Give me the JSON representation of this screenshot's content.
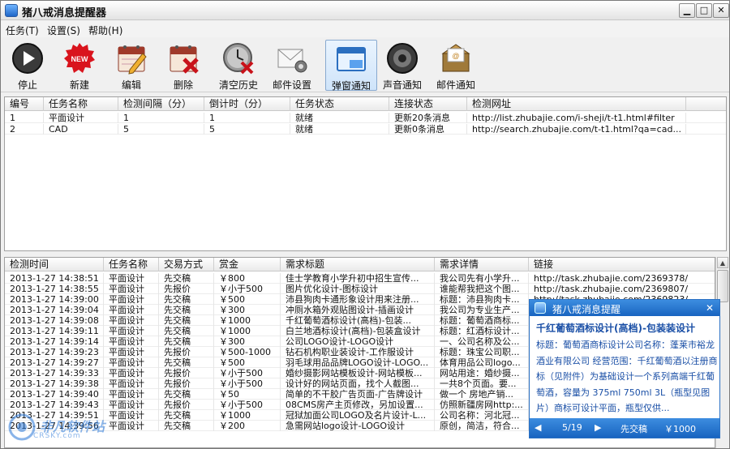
{
  "window": {
    "title": "猪八戒消息提醒器"
  },
  "menu": [
    {
      "label": "任务(T)"
    },
    {
      "label": "设置(S)"
    },
    {
      "label": "帮助(H)"
    }
  ],
  "toolbar": [
    {
      "label": "停止",
      "icon": "stop-icon"
    },
    {
      "label": "新建",
      "icon": "new-icon",
      "badge": "NEW"
    },
    {
      "label": "编辑",
      "icon": "edit-calendar-icon"
    },
    {
      "label": "删除",
      "icon": "delete-calendar-icon"
    },
    {
      "label": "清空历史",
      "icon": "clear-history-clock-icon"
    },
    {
      "label": "邮件设置",
      "icon": "mail-settings-icon"
    },
    {
      "label": "弹窗通知",
      "icon": "popup-notify-icon",
      "active": true
    },
    {
      "label": "声音通知",
      "icon": "speaker-icon"
    },
    {
      "label": "邮件通知",
      "icon": "mail-notify-icon"
    }
  ],
  "tasks": {
    "columns": [
      "编号",
      "任务名称",
      "检测间隔（分）",
      "倒计时（分）",
      "任务状态",
      "连接状态",
      "检测网址"
    ],
    "rows": [
      [
        "1",
        "平面设计",
        "1",
        "1",
        "就绪",
        "更新20条消息",
        "http://list.zhubajie.com/i-sheji/t-t1.html#filter"
      ],
      [
        "2",
        "CAD",
        "5",
        "5",
        "就绪",
        "更新0条消息",
        "http://search.zhubajie.com/t-t1.html?qa=cad..."
      ]
    ]
  },
  "history": {
    "columns": [
      "检测时间",
      "任务名称",
      "交易方式",
      "赏金",
      "需求标题",
      "需求详情",
      "链接"
    ],
    "rows": [
      [
        "2013-1-27  14:38:51",
        "平面设计",
        "先交稿",
        "￥800",
        "佳士学教育小学升初中招生宣传...",
        "我公司先有小学升...",
        "http://task.zhubajie.com/2369378/"
      ],
      [
        "2013-1-27  14:38:55",
        "平面设计",
        "先报价",
        "￥小于500",
        "图片优化设计-图标设计",
        "谁能帮我把这个图...",
        "http://task.zhubajie.com/2369807/"
      ],
      [
        "2013-1-27  14:39:00",
        "平面设计",
        "先交稿",
        "￥500",
        "沛县狗肉卡通形象设计用来注册...",
        "标题：沛县狗肉卡...",
        "http://task.zhubajie.com/2369823/"
      ],
      [
        "2013-1-27  14:39:04",
        "平面设计",
        "先交稿",
        "￥300",
        "冲厕水箱外观贴图设计-插画设计",
        "我公司为专业生产...",
        "http://task.zhubajie.com/2369…"
      ],
      [
        "2013-1-27  14:39:08",
        "平面设计",
        "先交稿",
        "￥1000",
        "千红葡萄酒标设计(高档)-包装...",
        "标题：葡萄酒商标...",
        "http://task.zhubajie.com/2369…"
      ],
      [
        "2013-1-27  14:39:11",
        "平面设计",
        "先交稿",
        "￥1000",
        "白兰地酒标设计(高档)-包装盒设计",
        "标题：红酒标设计...",
        "http://task.zhubajie.com/2369…"
      ],
      [
        "2013-1-27  14:39:14",
        "平面设计",
        "先交稿",
        "￥300",
        "公司LOGO设计-LOGO设计",
        "一、公司名称及公...",
        "http://task.zhubajie.com/2369…"
      ],
      [
        "2013-1-27  14:39:23",
        "平面设计",
        "先报价",
        "￥500-1000",
        "钻石机构职业装设计-工作服设计",
        "标题：珠宝公司职...",
        "http://task.zhubajie.com/2369…"
      ],
      [
        "2013-1-27  14:39:27",
        "平面设计",
        "先交稿",
        "￥500",
        "羽毛球用品品牌LOGO设计-LOGO...",
        "体育用品公司logo...",
        "http://task.zhubajie.com/2369…"
      ],
      [
        "2013-1-27  14:39:33",
        "平面设计",
        "先报价",
        "￥小于500",
        "婚纱摄影网站模板设计-网站模板...",
        "网站用途：婚纱摄...",
        "http://task.zhubajie.com/2369…"
      ],
      [
        "2013-1-27  14:39:38",
        "平面设计",
        "先报价",
        "￥小于500",
        "设计好的网站页面，找个人截图...",
        "一共8个页面。要...",
        "http://task.zhubajie.com/2369…"
      ],
      [
        "2013-1-27  14:39:40",
        "平面设计",
        "先交稿",
        "￥50",
        "简单的不干胶广告页面-广告牌设计",
        "做一个  房地产销...",
        "http://task.zhubajie.com/2369…"
      ],
      [
        "2013-1-27  14:39:43",
        "平面设计",
        "先报价",
        "￥小于500",
        "08CMS房产主页修改，另加设置...",
        "仿照新疆房网http:...",
        "http://task.zhubajie.com/2369…"
      ],
      [
        "2013-1-27  14:39:51",
        "平面设计",
        "先交稿",
        "￥1000",
        "冠狱加面公司LOGO及名片设计-L...",
        "公司名称：河北冠...",
        "http://task.zhubajie.com/2369…"
      ],
      [
        "2013-1-27  14:39:56",
        "平面设计",
        "先交稿",
        "￥200",
        "急需网站logo设计-LOGO设计",
        "原创，简洁，符合...",
        "http://task.zhubajie.com/2369731/"
      ]
    ]
  },
  "popup": {
    "title": "猪八戒消息提醒",
    "headline": "千红葡萄酒标设计(高档)-包装装设计",
    "body": "标题：葡萄酒商标设计公司名称：蓬莱市裕龙酒业有限公司  经营范围：千红葡萄酒以注册商标（见附件）为基础设计一个系列高端千红葡萄酒，容量为 375ml 750ml 3L（瓶型见图片）商标可设计平面，瓶型仅供...",
    "page": "5/19",
    "mode": "先交稿",
    "reward": "￥1000"
  },
  "watermark": {
    "text": "非凡软件站",
    "sub": "CRSKY.com"
  }
}
